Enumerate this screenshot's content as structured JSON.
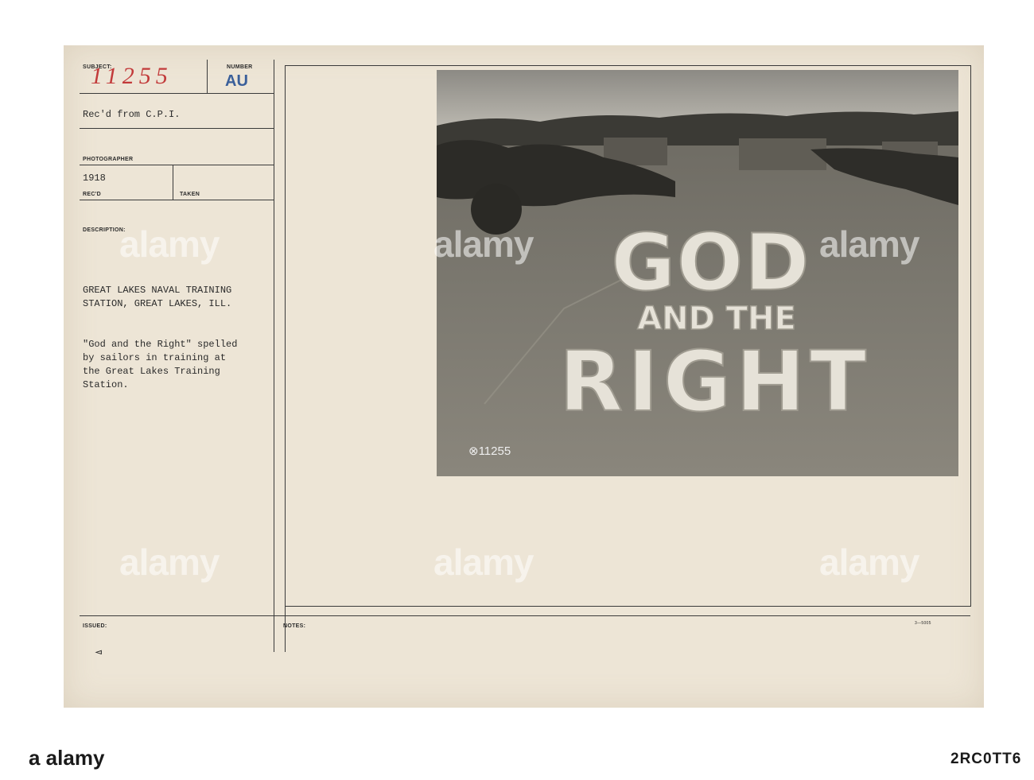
{
  "card": {
    "subject_label": "SUBJECT:",
    "subject_number": "11255",
    "number_label": "NUMBER",
    "number_stamp": "AU",
    "received_from": "Rec'd from C.P.I.",
    "photographer_label": "PHOTOGRAPHER",
    "year": "1918",
    "recd_label": "REC'D",
    "taken_label": "TAKEN",
    "description_label": "DESCRIPTION:",
    "location_line1": "GREAT LAKES NAVAL TRAINING",
    "location_line2": "STATION, GREAT LAKES, ILL.",
    "desc_line1": "\"God and the Right\" spelled",
    "desc_line2": "by sailors in training at",
    "desc_line3": "the Great Lakes Training",
    "desc_line4": "Station.",
    "issued_label": "ISSUED:",
    "notes_label": "NOTES:",
    "form_code": "3—5005"
  },
  "photo": {
    "word1": "GOD",
    "word2": "AND THE",
    "word3": "RIGHT",
    "negative_number": "⊗11255"
  },
  "watermark": {
    "text": "alamy",
    "logo": "a alamy",
    "image_id": "2RC0TT6"
  }
}
